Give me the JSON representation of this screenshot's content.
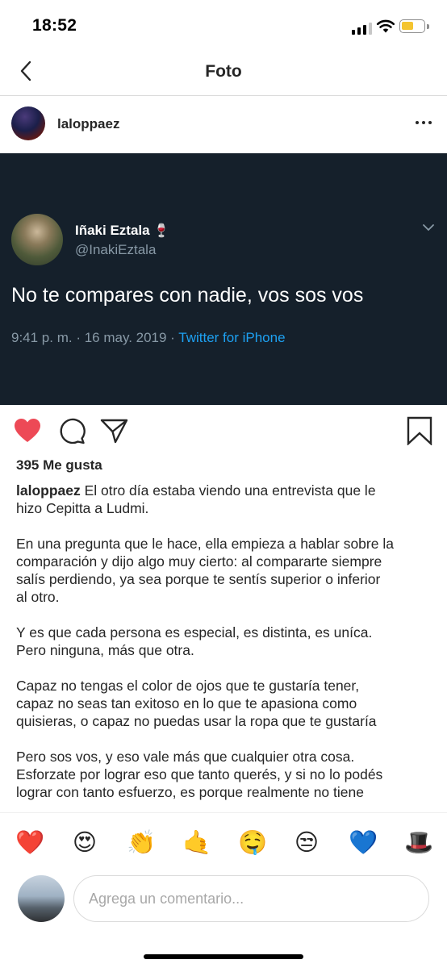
{
  "status_bar": {
    "time": "18:52"
  },
  "header": {
    "title": "Foto"
  },
  "post": {
    "username": "laloppaez",
    "tweet": {
      "name": "Iñaki Eztala",
      "name_emoji": "🍷",
      "handle": "@InakiEztala",
      "text": "No te compares con nadie, vos sos vos",
      "meta": "9:41 p. m. · 16 may. 2019 · ",
      "source": "Twitter for iPhone"
    },
    "likes": "395 Me gusta",
    "caption": {
      "username": "laloppaez",
      "line1": " El otro día estaba viendo una entrevista que le",
      "line2": "hizo Cepitta a Ludmi.",
      "p2_line1": "En una pregunta que le hace, ella empieza a hablar sobre la",
      "p2_line2": "comparación y dijo algo muy cierto: al compararte siempre",
      "p2_line3": "salís perdiendo, ya sea porque te sentís superior o inferior",
      "p2_line4": "al otro.",
      "p3_line1": "Y es que cada persona es especial, es distinta, es uníca.",
      "p3_line2": "Pero ninguna, más que otra.",
      "p4_line1": "Capaz no tengas el color de ojos que te gustaría tener,",
      "p4_line2": "capaz no seas tan exitoso en lo que te apasiona como",
      "p4_line3": "quisieras, o capaz no puedas usar la ropa que te gustaría",
      "p5_line1": "Pero sos vos, y eso vale más que cualquier otra cosa.",
      "p5_line2": "Esforzate por lograr eso que tanto querés, y si no lo podés",
      "p5_line3": "lograr con tanto esfuerzo, es porque realmente no tiene"
    }
  },
  "emoji_bar": [
    "❤️",
    "😍",
    "👏",
    "🤙",
    "🤤",
    "😒",
    "💙",
    "🎩"
  ],
  "composer": {
    "placeholder": "Agrega un comentario..."
  },
  "colors": {
    "like_red": "#ed4956",
    "tweet_bg": "#15202b",
    "twitter_blue": "#1da1f2",
    "battery_yellow": "#f4c430"
  },
  "icons": [
    "back-chevron-icon",
    "more-dots-icon",
    "heart-icon",
    "comment-icon",
    "share-icon",
    "bookmark-icon"
  ]
}
